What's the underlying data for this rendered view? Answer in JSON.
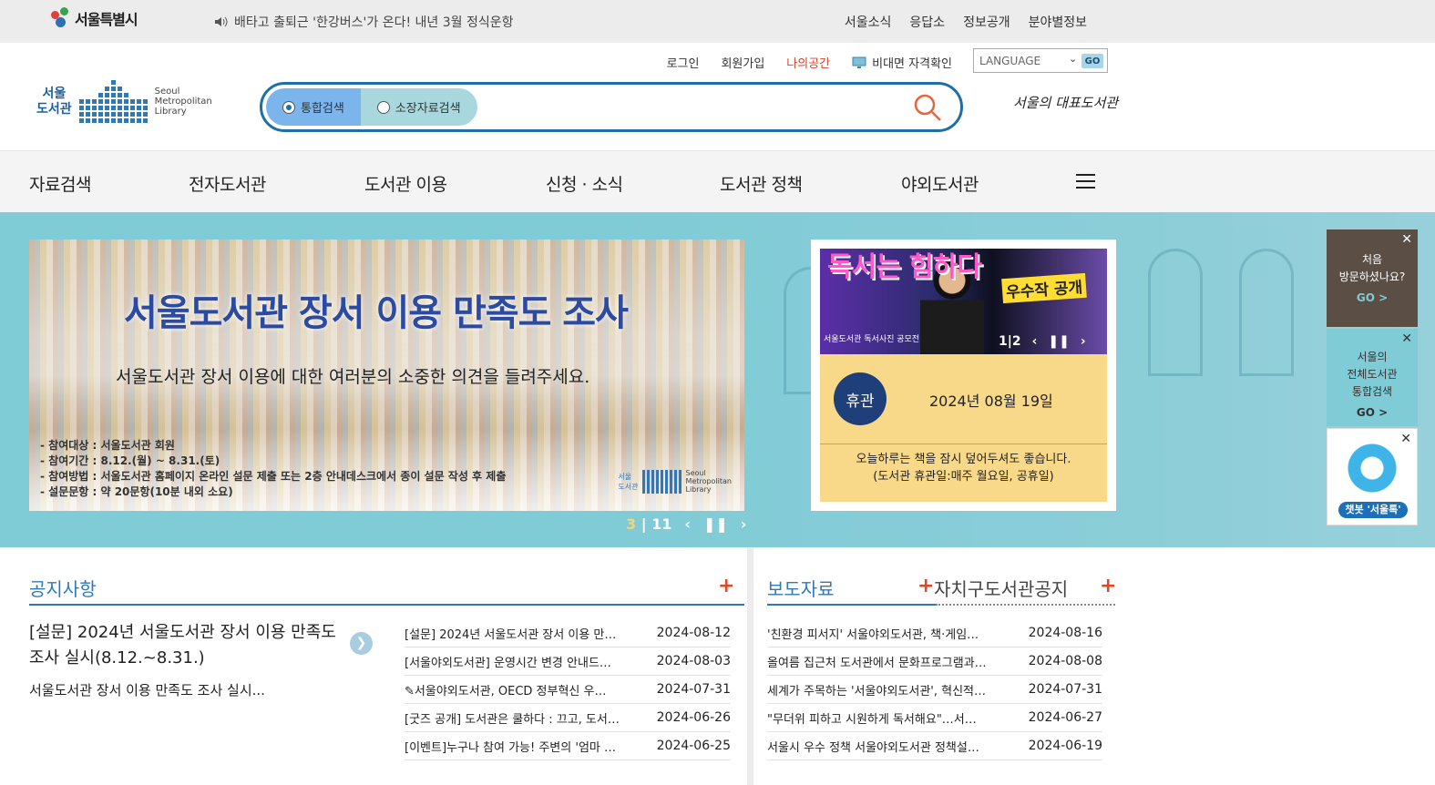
{
  "topbar": {
    "logo_text": "서울특별시",
    "notice": "배타고 출퇴근 '한강버스'가 온다! 내년 3월 정식운항",
    "links": [
      "서울소식",
      "응답소",
      "정보공개",
      "분야별정보"
    ]
  },
  "util": {
    "login": "로그인",
    "join": "회원가입",
    "mine": "나의공간",
    "verify": "비대면 자격확인",
    "language_label": "LANGUAGE",
    "language_go": "GO"
  },
  "logo": {
    "ko": "서울\n도서관",
    "en": "Seoul\nMetropolitan\nLibrary"
  },
  "search": {
    "tab_all": "통합검색",
    "tab_holdings": "소장자료검색",
    "value": ""
  },
  "slogan": "서울의 대표도서관",
  "gnb": [
    "자료검색",
    "전자도서관",
    "도서관 이용",
    "신청 · 소식",
    "도서관 정책",
    "야외도서관"
  ],
  "hero": {
    "title": "서울도서관 장서 이용 만족도 조사",
    "subtitle": "서울도서관 장서 이용에 대한 여러분의 소중한 의견을 들려주세요.",
    "details": [
      "- 참여대상 : 서울도서관 회원",
      "- 참여기간 : 8.12.(월) ~ 8.31.(토)",
      "- 참여방법 : 서울도서관 홈페이지 온라인 설문 제출 또는 2층 안내데스크에서 종이 설문 작성 후 제출",
      "- 설문문항 : 약 20문항(10분 내외 소요)"
    ],
    "mini_logo_ko": "서울\n도서관",
    "mini_logo_en": "Seoul\nMetropolitan\nLibrary",
    "pager_current": "3",
    "pager_total": "11"
  },
  "side": {
    "thumb_title": "독서는 힘하다",
    "thumb_badge": "우수작 공개",
    "thumb_caption": "서울도서관 독서사진 공모전",
    "pager_current": "1",
    "pager_total": "2",
    "closed_label": "휴관",
    "date": "2024년 08월 19일",
    "msg1": "오늘하루는 책을 잠시 덮어두셔도 좋습니다.",
    "msg2": "(도서관 휴관일:매주 월요일, 공휴일)"
  },
  "quick": {
    "first_visit_1": "처음",
    "first_visit_2": "방문하셨나요?",
    "first_visit_go": "GO  >",
    "unified_1": "서울의",
    "unified_2": "전체도서관",
    "unified_3": "통합검색",
    "unified_go": "GO  >",
    "chatbot_label": "챗봇 '서울톡'"
  },
  "notice": {
    "title": "공지사항",
    "featured_title": "[설문] 2024년 서울도서관 장서 이용 만족도 조사 실시(8.12.~8.31.)",
    "featured_summary": "서울도서관 장서 이용 만족도 조사 실시...",
    "items": [
      {
        "title": "[설문] 2024년 서울도서관 장서 이용 만…",
        "date": "2024-08-12"
      },
      {
        "title": "[서울야외도서관] 운영시간 변경 안내드…",
        "date": "2024-08-03"
      },
      {
        "title": "서울야외도서관, OECD 정부혁신 우…",
        "date": "2024-07-31"
      },
      {
        "title": "[굿즈 공개] 도서관은 쿨하다 : 끄고, 도서…",
        "date": "2024-06-26"
      },
      {
        "title": "[이벤트]누구나 참여 가능! 주변의 '엄마 …",
        "date": "2024-06-25"
      }
    ]
  },
  "press": {
    "title": "보도자료",
    "tab2": "자치구도서관공지",
    "items": [
      {
        "title": "'친환경 피서지' 서울야외도서관, 책·게임…",
        "date": "2024-08-16"
      },
      {
        "title": "올여름 집근처 도서관에서 문화프로그램과…",
        "date": "2024-08-08"
      },
      {
        "title": "세계가 주목하는 '서울야외도서관', 혁신적…",
        "date": "2024-07-31"
      },
      {
        "title": "\"무더위 피하고 시원하게 독서해요\"…서…",
        "date": "2024-06-27"
      },
      {
        "title": "서울시 우수 정책 서울야외도서관 정책설…",
        "date": "2024-06-19"
      }
    ]
  },
  "colors": {
    "primary": "#2f79b8",
    "accent": "#d94a2a",
    "hero_bg": "#7fcbd6",
    "info_bg": "#f8d98a"
  }
}
